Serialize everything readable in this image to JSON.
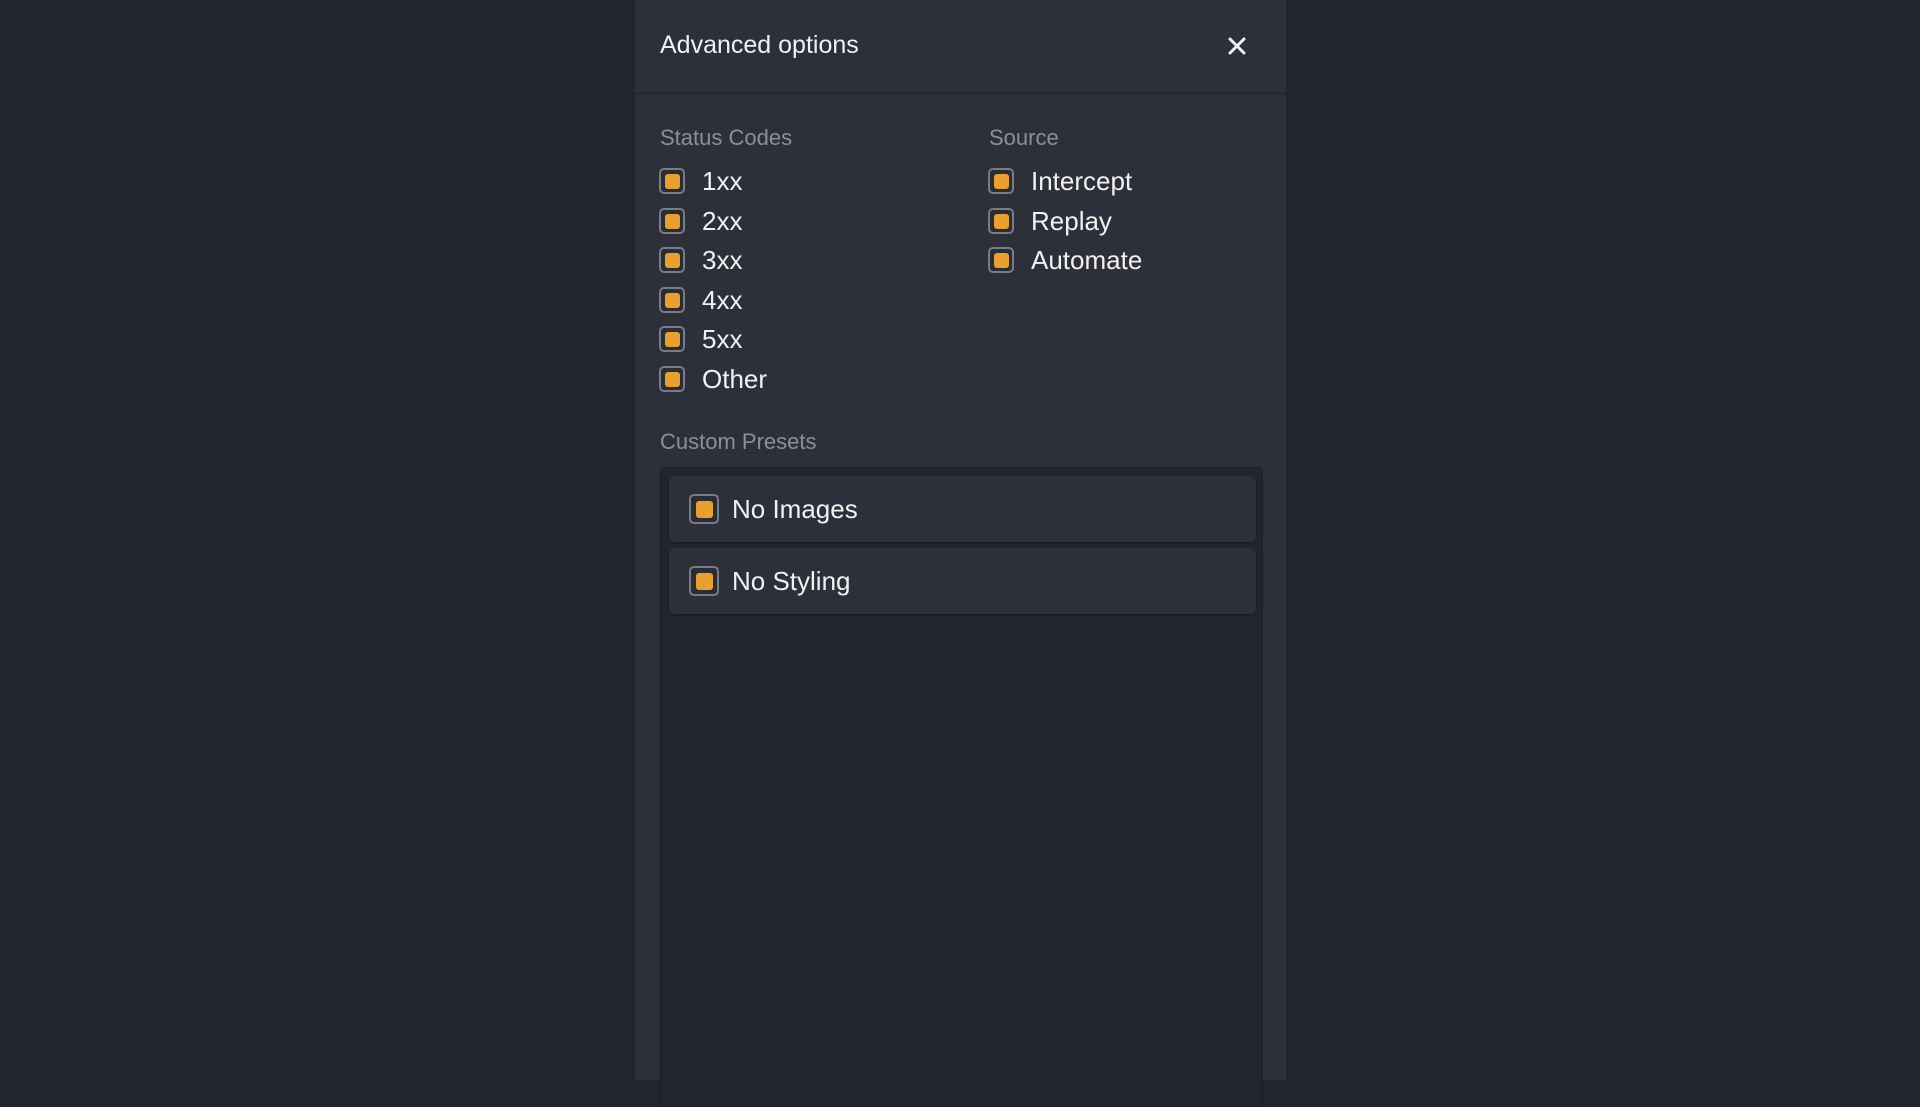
{
  "dialog": {
    "title": "Advanced options",
    "close_icon": "close-icon"
  },
  "status_codes": {
    "label": "Status Codes",
    "items": [
      {
        "label": "1xx",
        "checked": true
      },
      {
        "label": "2xx",
        "checked": true
      },
      {
        "label": "3xx",
        "checked": true
      },
      {
        "label": "4xx",
        "checked": true
      },
      {
        "label": "5xx",
        "checked": true
      },
      {
        "label": "Other",
        "checked": true
      }
    ]
  },
  "source": {
    "label": "Source",
    "items": [
      {
        "label": "Intercept",
        "checked": true
      },
      {
        "label": "Replay",
        "checked": true
      },
      {
        "label": "Automate",
        "checked": true
      }
    ]
  },
  "custom_presets": {
    "label": "Custom Presets",
    "items": [
      {
        "label": "No Images",
        "checked": true
      },
      {
        "label": "No Styling",
        "checked": true
      }
    ]
  },
  "colors": {
    "accent": "#e8a030",
    "panel": "#2d303a",
    "background": "#22252e"
  }
}
